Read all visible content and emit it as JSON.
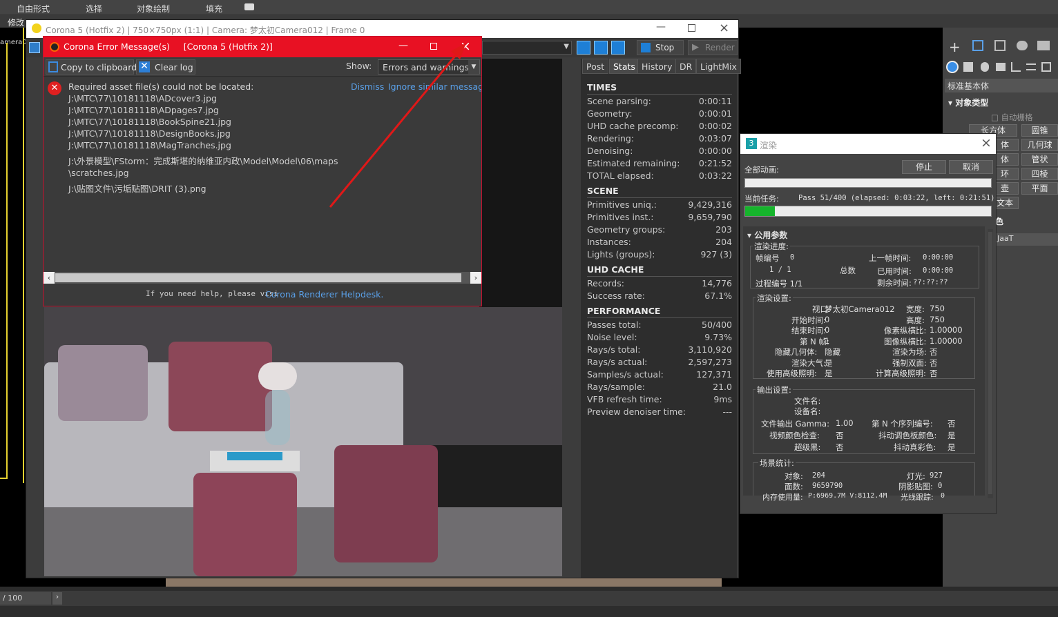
{
  "menubar": {
    "items": [
      "自由形式",
      "选择",
      "对象绘制",
      "填充"
    ],
    "modify": "修改"
  },
  "viewport": {
    "camera_label": "amera0"
  },
  "vfb": {
    "title": "Corona 5 (Hotfix 2) | 750×750px (1:1) | Camera: 梦太初Camera012 | Frame 0",
    "stop_label": "Stop",
    "render_label": "Render",
    "tabs": [
      "Post",
      "Stats",
      "History",
      "DR",
      "LightMix"
    ],
    "active_tab": "Stats",
    "stats": {
      "times_header": "TIMES",
      "times": [
        {
          "k": "Scene parsing:",
          "v": "0:00:11"
        },
        {
          "k": "Geometry:",
          "v": "0:00:01"
        },
        {
          "k": "UHD cache precomp:",
          "v": "0:00:02"
        },
        {
          "k": "Rendering:",
          "v": "0:03:07"
        },
        {
          "k": "Denoising:",
          "v": "0:00:00"
        },
        {
          "k": "Estimated remaining:",
          "v": "0:21:52"
        },
        {
          "k": "TOTAL elapsed:",
          "v": "0:03:22"
        }
      ],
      "scene_header": "SCENE",
      "scene": [
        {
          "k": "Primitives uniq.:",
          "v": "9,429,316"
        },
        {
          "k": "Primitives inst.:",
          "v": "9,659,790"
        },
        {
          "k": "Geometry groups:",
          "v": "203"
        },
        {
          "k": "Instances:",
          "v": "204"
        },
        {
          "k": "Lights (groups):",
          "v": "927 (3)"
        }
      ],
      "uhd_header": "UHD CACHE",
      "uhd": [
        {
          "k": "Records:",
          "v": "14,776"
        },
        {
          "k": "Success rate:",
          "v": "67.1%"
        }
      ],
      "perf_header": "PERFORMANCE",
      "perf": [
        {
          "k": "Passes total:",
          "v": "50/400"
        },
        {
          "k": "Noise level:",
          "v": "9.73%"
        },
        {
          "k": "Rays/s total:",
          "v": "3,110,920"
        },
        {
          "k": "Rays/s actual:",
          "v": "2,597,273"
        },
        {
          "k": "Samples/s actual:",
          "v": "127,371"
        },
        {
          "k": "Rays/sample:",
          "v": "21.0"
        },
        {
          "k": "VFB refresh time:",
          "v": "9ms"
        },
        {
          "k": "Preview denoiser time:",
          "v": "---"
        }
      ]
    }
  },
  "error_dialog": {
    "title": "Corona Error Message(s)     [Corona 5 (Hotfix 2)]",
    "copy_label": "Copy to clipboard",
    "clear_label": "Clear log",
    "show_label": "Show:",
    "show_value": "Errors and warnings",
    "message_header": "Required asset file(s) could not be located:",
    "dismiss": "Dismiss",
    "ignore": "Ignore similar message",
    "files": [
      "J:\\MTC\\77\\10181118\\ADcover3.jpg",
      "J:\\MTC\\77\\10181118\\ADpages7.jpg",
      "J:\\MTC\\77\\10181118\\BookSpine21.jpg",
      "J:\\MTC\\77\\10181118\\DesignBooks.jpg",
      "J:\\MTC\\77\\10181118\\MagTranches.jpg",
      "J:\\外景模型\\FStorm：完成斯堪的纳维亚内政\\Model\\Model\\06\\maps",
      "\\scratches.jpg",
      "J:\\贴图文件\\污垢贴图\\DRIT (3).png"
    ],
    "help_prefix": "If you need help, please visi",
    "help_link": "Corona Renderer Helpdesk."
  },
  "render_dialog": {
    "title": "渲染",
    "all_anim_label": "全部动画:",
    "stop_btn": "停止",
    "cancel_btn": "取消",
    "all_anim_progress": 0,
    "current_task_label": "当前任务:",
    "current_task": "Pass 51/400 (elapsed: 0:03:22, left: 0:21:51)",
    "current_task_progress": 0.12,
    "common_params": "公用参数",
    "progress_section": "渲染进度:",
    "frame_no_label": "帧编号",
    "frame_no": "0",
    "frame_count": "1 / 1",
    "total_label": "总数",
    "last_frame_label": "上一帧时间:",
    "last_frame": "0:00:00",
    "used_time_label": "已用时间:",
    "used_time": "0:00:00",
    "pass_label": "过程编号 1/1",
    "remaining_label": "剩余时间:",
    "remaining": "??:??:??",
    "settings_section": "渲染设置:",
    "settings_left": [
      {
        "k": "视口:",
        "v": "梦太初Camera012"
      },
      {
        "k": "开始时间:",
        "v": "0"
      },
      {
        "k": "结束时间:",
        "v": "0"
      },
      {
        "k": "第 N 帧:",
        "v": "1"
      },
      {
        "k": "隐藏几何体:",
        "v": "隐藏"
      },
      {
        "k": "渲染大气:",
        "v": "是"
      },
      {
        "k": "使用高级照明:",
        "v": "是"
      }
    ],
    "settings_right": [
      {
        "k": "宽度:",
        "v": "750"
      },
      {
        "k": "高度:",
        "v": "750"
      },
      {
        "k": "像素纵横比:",
        "v": "1.00000"
      },
      {
        "k": "图像纵横比:",
        "v": "1.00000"
      },
      {
        "k": "渲染为场:",
        "v": "否"
      },
      {
        "k": "强制双面:",
        "v": "否"
      },
      {
        "k": "计算高级照明:",
        "v": "否"
      }
    ],
    "output_section": "输出设置:",
    "file_name_label": "文件名:",
    "device_name_label": "设备名:",
    "output_left": [
      {
        "k": "文件输出 Gamma:",
        "v": "1.00"
      },
      {
        "k": "视频颜色检查:",
        "v": "否"
      },
      {
        "k": "超级黑:",
        "v": "否"
      }
    ],
    "output_right": [
      {
        "k": "第 N 个序列编号:",
        "v": "否"
      },
      {
        "k": "抖动调色板颜色:",
        "v": "是"
      },
      {
        "k": "抖动真彩色:",
        "v": "是"
      }
    ],
    "scene_section": "场景统计:",
    "objects_label": "对象:",
    "objects": "204",
    "faces_label": "面数:",
    "faces": "9659790",
    "memory_label": "内存使用量:",
    "memory": "P:6969.7M V:8112.4M",
    "lights_label": "灯光:",
    "lights": "927",
    "shadow_label": "阴影贴图:",
    "shadow": "0",
    "raytrace_label": "光线跟踪:",
    "raytrace": "0"
  },
  "cmd_panel": {
    "standard": "标准基本体",
    "obj_type": "对象类型",
    "autogrid": "自动栅格",
    "buttons": [
      "长方体",
      "圆锥",
      "几何球",
      "管状",
      "四棱",
      "平面"
    ],
    "partials": [
      "体",
      "体",
      "环",
      "壶",
      "文本"
    ],
    "name_color": "色",
    "jaat": "JaaT"
  },
  "timeline": {
    "frame": "/ 100"
  }
}
